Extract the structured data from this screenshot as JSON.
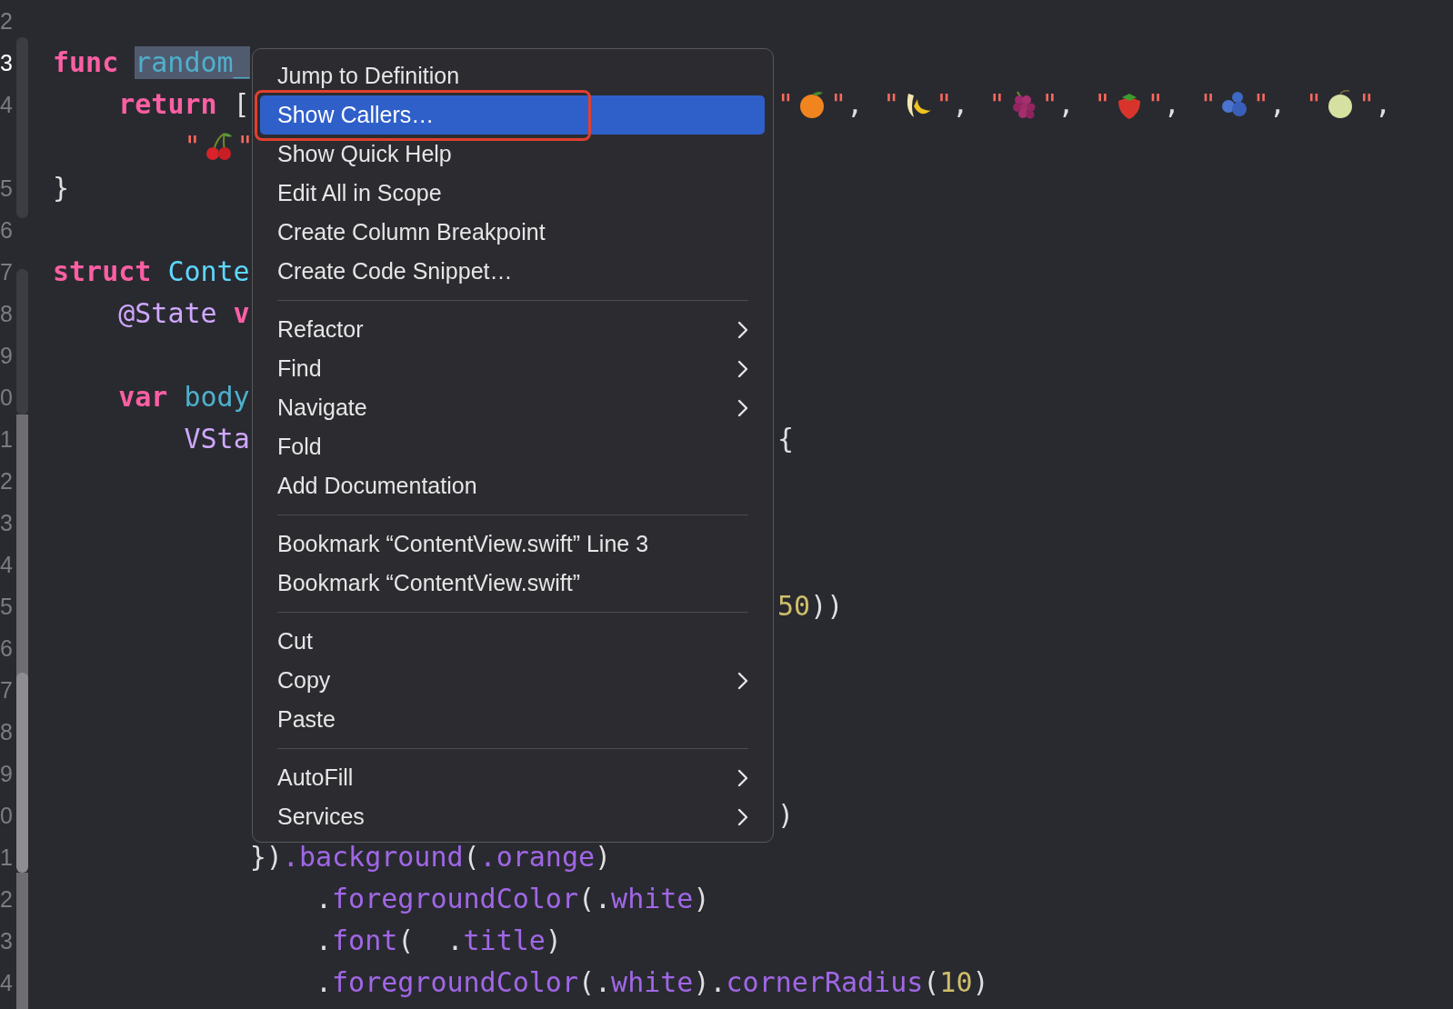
{
  "editor": {
    "lines": [
      {
        "number": "2",
        "current": false,
        "kind": "flush"
      },
      {
        "number": "3",
        "current": true,
        "kind": "flush",
        "left": [
          {
            "t": "func",
            "kind": "keyword"
          },
          {
            "t": "random_",
            "kind": "declaration",
            "highlighted": true
          }
        ]
      },
      {
        "number": "4",
        "current": false,
        "kind": "inset",
        "left": [
          {
            "t": "return",
            "kind": "keyword"
          },
          {
            "t": "[",
            "kind": "plain"
          }
        ],
        "right": [
          {
            "t": "\"",
            "kind": "string"
          },
          {
            "kind": "emoji"
          },
          {
            "t": "\"",
            "kind": "string"
          },
          {
            "t": ",",
            "kind": "separator"
          },
          {
            "t": "\"",
            "kind": "string"
          },
          {
            "kind": "emoji"
          },
          {
            "t": "\"",
            "kind": "string"
          },
          {
            "t": ",",
            "kind": "separator"
          },
          {
            "t": "\"",
            "kind": "string"
          },
          {
            "kind": "emoji"
          },
          {
            "t": "\"",
            "kind": "string"
          },
          {
            "t": ",",
            "kind": "separator"
          },
          {
            "t": "\"",
            "kind": "string"
          },
          {
            "kind": "emoji"
          },
          {
            "t": "\"",
            "kind": "string"
          },
          {
            "t": ",",
            "kind": "separator"
          },
          {
            "t": "\"",
            "kind": "string"
          },
          {
            "kind": "emoji"
          },
          {
            "t": "\"",
            "kind": "string"
          },
          {
            "t": ",",
            "kind": "separator"
          },
          {
            "t": "\"",
            "kind": "string"
          },
          {
            "kind": "emoji"
          },
          {
            "t": "\"",
            "kind": "string"
          },
          {
            "t": ",",
            "kind": "separator"
          }
        ]
      },
      {
        "kind": "inset2",
        "left": [
          {
            "t": "\"",
            "kind": "string"
          },
          {
            "kind": "emoji"
          },
          {
            "t": "\"",
            "kind": "string"
          }
        ]
      },
      {
        "number": "5",
        "current": false,
        "kind": "flush",
        "left": [
          {
            "t": "}",
            "kind": "plain"
          }
        ]
      },
      {
        "number": "6",
        "current": false,
        "kind": "flush"
      },
      {
        "number": "7",
        "current": false,
        "kind": "flush",
        "left": [
          {
            "t": "struct",
            "kind": "keyword"
          },
          {
            "t": "Conte",
            "kind": "type"
          }
        ]
      },
      {
        "number": "8",
        "current": false,
        "kind": "inset",
        "left": [
          {
            "t": "@State",
            "kind": "attribute"
          },
          {
            "t": "v",
            "kind": "keyword"
          }
        ]
      },
      {
        "number": "9",
        "current": false,
        "kind": "flush"
      },
      {
        "number": "0",
        "current": false,
        "kind": "inset",
        "left": [
          {
            "t": "var",
            "kind": "keyword"
          },
          {
            "t": "body",
            "kind": "declaration"
          }
        ]
      },
      {
        "number": "1",
        "current": false,
        "kind": "inset2",
        "left": [
          {
            "t": "VSta",
            "kind": "attribute"
          }
        ],
        "right": [
          {
            "t": "{",
            "kind": "brace"
          }
        ]
      },
      {
        "number": "2",
        "current": false,
        "kind": "flush"
      },
      {
        "number": "3",
        "current": false,
        "kind": "flush"
      },
      {
        "number": "4",
        "current": false,
        "kind": "flush"
      },
      {
        "number": "5",
        "current": false,
        "kind": "flush",
        "right": [
          {
            "t": "50",
            "kind": "number"
          },
          {
            "t": "))",
            "kind": "plain"
          }
        ]
      },
      {
        "number": "6",
        "current": false,
        "kind": "flush"
      },
      {
        "number": "7",
        "current": false,
        "kind": "flush"
      },
      {
        "number": "8",
        "current": false,
        "kind": "flush"
      },
      {
        "number": "9",
        "current": false,
        "kind": "flush"
      },
      {
        "number": "0",
        "current": false,
        "kind": "flush",
        "right": [
          {
            "t": ")",
            "kind": "plain"
          }
        ]
      },
      {
        "number": "1",
        "current": false,
        "kind": "inset3",
        "left": [
          {
            "t": "})",
            "kind": "plain"
          },
          {
            "t": ".background",
            "kind": "member"
          },
          {
            "t": "(",
            "kind": "plain"
          },
          {
            "t": ".orange",
            "kind": "member"
          },
          {
            "t": ")",
            "kind": "plain"
          }
        ]
      },
      {
        "number": "2",
        "current": false,
        "kind": "inset4",
        "left": [
          {
            "t": ".",
            "kind": "plain"
          },
          {
            "t": "foregroundColor",
            "kind": "member"
          },
          {
            "t": "(.",
            "kind": "plain"
          },
          {
            "t": "white",
            "kind": "member"
          },
          {
            "t": ")",
            "kind": "plain"
          }
        ]
      },
      {
        "number": "3",
        "current": false,
        "kind": "inset4",
        "left": [
          {
            "t": ".",
            "kind": "plain"
          },
          {
            "t": "font",
            "kind": "member"
          },
          {
            "t": "(  .",
            "kind": "plain"
          },
          {
            "t": "title",
            "kind": "member"
          },
          {
            "t": ")",
            "kind": "plain"
          }
        ]
      },
      {
        "number": "4",
        "current": false,
        "kind": "inset4",
        "left": [
          {
            "t": ".",
            "kind": "plain"
          },
          {
            "t": "foregroundColor",
            "kind": "member"
          },
          {
            "t": "(.",
            "kind": "plain"
          },
          {
            "t": "white",
            "kind": "member"
          },
          {
            "t": ").",
            "kind": "plain"
          },
          {
            "t": "cornerRadius",
            "kind": "member"
          },
          {
            "t": "(",
            "kind": "plain"
          },
          {
            "t": "10",
            "kind": "number"
          },
          {
            "t": ")",
            "kind": "plain"
          }
        ]
      }
    ]
  },
  "context_menu": {
    "groups": [
      [
        {
          "label": "Jump to Definition",
          "selected": false,
          "submenu": false,
          "outlined": false
        },
        {
          "label": "Show Callers…",
          "selected": true,
          "submenu": false,
          "outlined": true
        },
        {
          "label": "Show Quick Help",
          "selected": false,
          "submenu": false,
          "outlined": false
        },
        {
          "label": "Edit All in Scope",
          "selected": false,
          "submenu": false,
          "outlined": false
        },
        {
          "label": "Create Column Breakpoint",
          "selected": false,
          "submenu": false,
          "outlined": false
        },
        {
          "label": "Create Code Snippet…",
          "selected": false,
          "submenu": false,
          "outlined": false
        }
      ],
      [
        {
          "label": "Refactor",
          "selected": false,
          "submenu": true,
          "outlined": false
        },
        {
          "label": "Find",
          "selected": false,
          "submenu": true,
          "outlined": false
        },
        {
          "label": "Navigate",
          "selected": false,
          "submenu": true,
          "outlined": false
        },
        {
          "label": "Fold",
          "selected": false,
          "submenu": false,
          "outlined": false
        },
        {
          "label": "Add Documentation",
          "selected": false,
          "submenu": false,
          "outlined": false
        }
      ],
      [
        {
          "label": "Bookmark “ContentView.swift” Line 3",
          "selected": false,
          "submenu": false,
          "outlined": false
        },
        {
          "label": "Bookmark “ContentView.swift”",
          "selected": false,
          "submenu": false,
          "outlined": false
        }
      ],
      [
        {
          "label": "Cut",
          "selected": false,
          "submenu": false,
          "outlined": false
        },
        {
          "label": "Copy",
          "selected": false,
          "submenu": true,
          "outlined": false
        },
        {
          "label": "Paste",
          "selected": false,
          "submenu": false,
          "outlined": false
        }
      ],
      [
        {
          "label": "AutoFill",
          "selected": false,
          "submenu": true,
          "outlined": false
        },
        {
          "label": "Services",
          "selected": false,
          "submenu": true,
          "outlined": false
        }
      ]
    ]
  }
}
